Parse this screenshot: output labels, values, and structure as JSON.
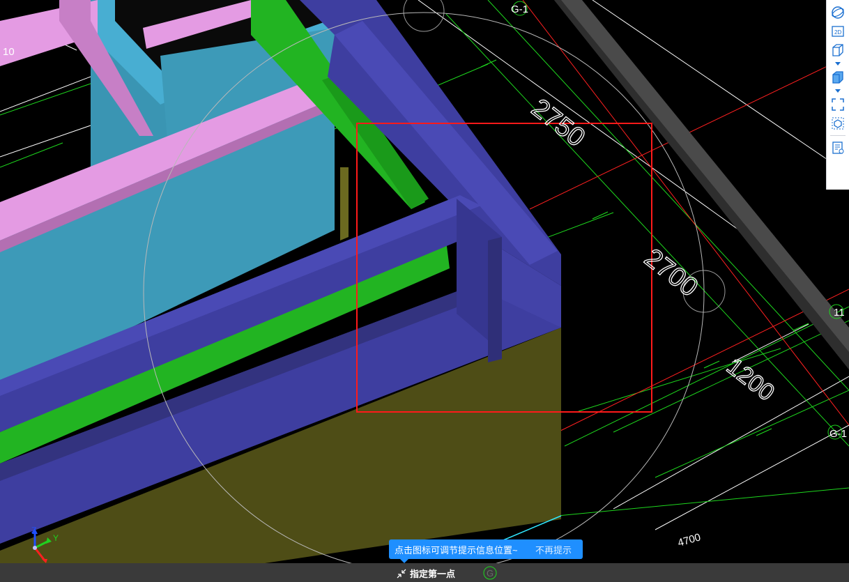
{
  "grid_labels": {
    "top_axis": "G-1",
    "left_axis": "10",
    "right_axis_upper": "11",
    "right_axis_lower": "G-1",
    "bottom_axis": "G"
  },
  "dimensions": {
    "d1": "2750",
    "d2": "2700",
    "d3": "1200",
    "d4": "4700"
  },
  "triad": {
    "z": "Z",
    "y": "Y"
  },
  "toolbar": {
    "mode_2d_label": "2D",
    "buttons": [
      "orbit-icon",
      "2d-view-icon",
      "3d-box-icon",
      "solid-view-icon",
      "zoom-extents-icon",
      "section-box-icon",
      "properties-view-icon"
    ]
  },
  "tip": {
    "text": "点击图标可调节提示信息位置~",
    "dismiss": "不再提示"
  },
  "status": {
    "command": "指定第一点"
  },
  "colors": {
    "beam_blue": "#3e3ea0",
    "slab_cyan": "#3d9ab8",
    "beam_pink": "#e49be3",
    "beam_green": "#22b422",
    "foundation_olive": "#4e4d16",
    "selection_red": "#ff1a1a",
    "tip_blue": "#1f8fff"
  }
}
